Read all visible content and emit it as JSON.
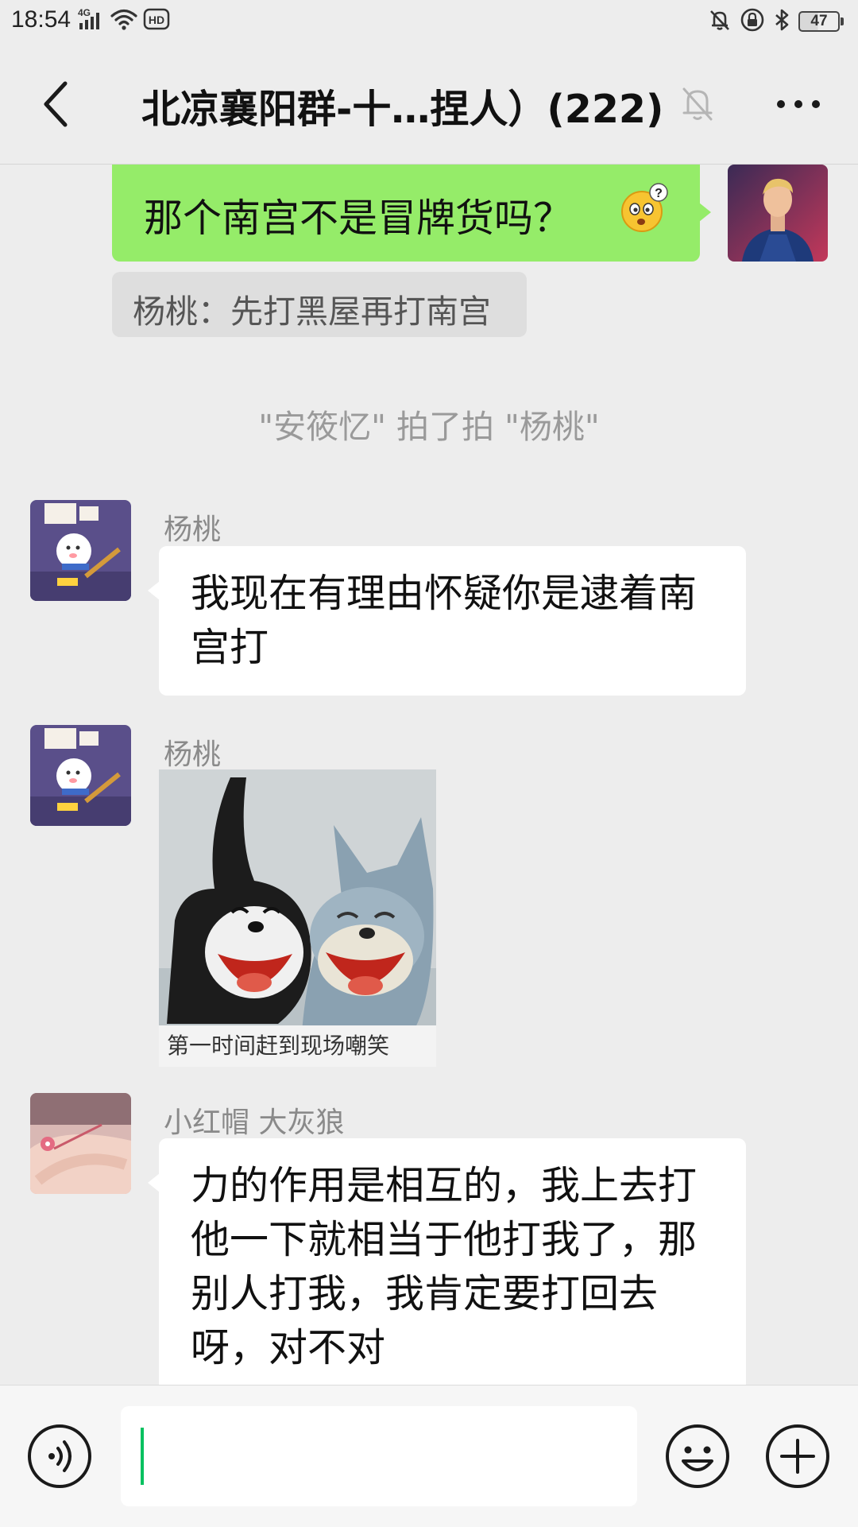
{
  "status_bar": {
    "time": "18:54",
    "network_label": "4G",
    "hd_label": "HD",
    "battery": "47"
  },
  "header": {
    "title": "北凉襄阳群-十…捏人）(222)",
    "back_icon": "chevron-left-icon",
    "mute_icon": "bell-off-icon",
    "more_icon": "more-icon"
  },
  "messages": [
    {
      "type": "outgoing-text",
      "text": "那个南宫不是冒牌货吗？",
      "emoji": "confused-face-emoji"
    },
    {
      "type": "quote",
      "text": "杨桃：先打黑屋再打南宫"
    },
    {
      "type": "system",
      "text": "\"安筱忆\" 拍了拍 \"杨桃\""
    },
    {
      "type": "incoming-text",
      "sender": "杨桃",
      "text": "我现在有理由怀疑你是逮着南宫打"
    },
    {
      "type": "incoming-sticker",
      "sender": "杨桃",
      "caption": "第一时间赶到现场嘲笑"
    },
    {
      "type": "incoming-text",
      "sender": "小红帽 大灰狼",
      "text": "力的作用是相互的，我上去打他一下就相当于他打我了，那别人打我，我肯定要打回去呀，对不对"
    }
  ],
  "input_bar": {
    "value": "",
    "voice_icon": "voice-icon",
    "emoji_icon": "emoji-icon",
    "plus_icon": "plus-icon"
  },
  "colors": {
    "background": "#ededed",
    "outgoing_bubble": "#95ec69",
    "incoming_bubble": "#ffffff",
    "accent": "#07c160"
  }
}
